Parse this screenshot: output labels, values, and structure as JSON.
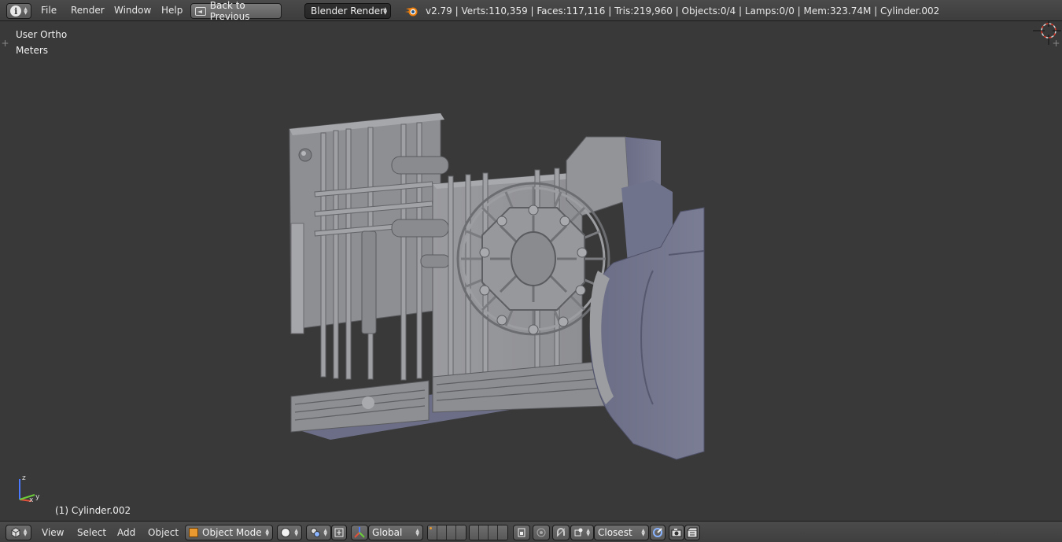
{
  "top_bar": {
    "menus": [
      "File",
      "Render",
      "Window",
      "Help"
    ],
    "back_button": "Back to Previous",
    "render_engine": "Blender Render",
    "stats": "v2.79 | Verts:110,359 | Faces:117,116 | Tris:219,960 | Objects:0/4 | Lamps:0/0 | Mem:323.74M | Cylinder.002"
  },
  "viewport": {
    "view_name": "User Ortho",
    "units": "Meters",
    "active_object": "(1) Cylinder.002",
    "axes": {
      "x": "x",
      "y": "y",
      "z": "z"
    }
  },
  "bottom_bar": {
    "menus": [
      "View",
      "Select",
      "Add",
      "Object"
    ],
    "mode": "Object Mode",
    "orientation": "Global",
    "snap_element": "Closest"
  },
  "colors": {
    "viewport_bg": "#393939",
    "header_bg": "#444444",
    "model_light": "#9a9b9e",
    "model_shadow": "#6b6e86",
    "axis_x": "#e0503a",
    "axis_y": "#6ccf3a",
    "axis_z": "#4a78ff"
  },
  "icons": {
    "editor_type": "info-icon",
    "back": "back-to-previous-icon",
    "logo": "blender-logo-icon",
    "viewport_editor": "3d-view-icon",
    "mode": "object-mode-cube-icon",
    "shading": "solid-shading-icon",
    "pivot": "pivot-point-icon",
    "manipulator": "manipulator-icon",
    "orientation": "transform-orientation-icon",
    "snap": "snap-magnet-icon",
    "render": "render-camera-icon",
    "anim": "render-animation-icon"
  }
}
